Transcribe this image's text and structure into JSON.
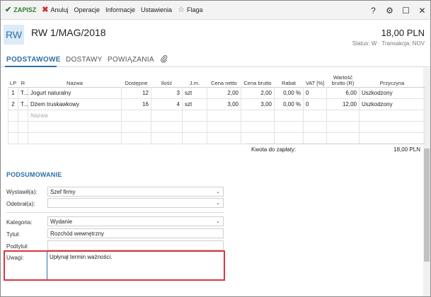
{
  "toolbar": {
    "save": "ZAPISZ",
    "cancel": "Anuluj",
    "operations": "Operacje",
    "info": "Informacje",
    "settings": "Ustawienia",
    "flag": "Flaga",
    "help": "?",
    "gear": "⚙",
    "maximize": "☐",
    "close": "✕"
  },
  "header": {
    "badge": "RW",
    "title": "RW 1/MAG/2018",
    "amount": "18,00 PLN",
    "status": "Status:  W  ·  Transakcja:  NOV"
  },
  "tabs": [
    "PODSTAWOWE",
    "DOSTAWY",
    "POWIĄZANIA"
  ],
  "table": {
    "headers": [
      "LP",
      "R",
      "Nazwa",
      "Dostępne",
      "Ilość",
      "J.m.",
      "Cena netto",
      "Cena brutto",
      "Rabat",
      "VAT [%]",
      "Wartość brutto (R)",
      "Przyczyna"
    ],
    "rows": [
      [
        "1",
        "T...",
        "Jogurt naturalny",
        "12",
        "3",
        "szt",
        "2,00",
        "2,00",
        "0,00 %",
        "0",
        "6,00",
        "Uszkodzony"
      ],
      [
        "2",
        "T...",
        "Dżem truskawkowy",
        "16",
        "4",
        "szt",
        "3,00",
        "3,00",
        "0,00 %",
        "0",
        "12,00",
        "Uszkodzony"
      ]
    ],
    "placeholder": "Nazwa"
  },
  "total": {
    "label": "Kwota do zapłaty:",
    "value": "18,00 PLN"
  },
  "summary": {
    "title": "PODSUMOWANIE",
    "issued_label": "Wystawił(a):",
    "issued_value": "Szef firmy",
    "received_label": "Odebrał(a):",
    "received_value": "",
    "category_label": "Kategoria:",
    "category_value": "Wydanie",
    "title_label": "Tytuł:",
    "title_value": "Rozchód wewnętrzny",
    "subtitle_label": "Podtytuł:",
    "subtitle_value": "",
    "notes_label": "Uwagi:",
    "notes_value": "Upłynął termin ważności."
  }
}
